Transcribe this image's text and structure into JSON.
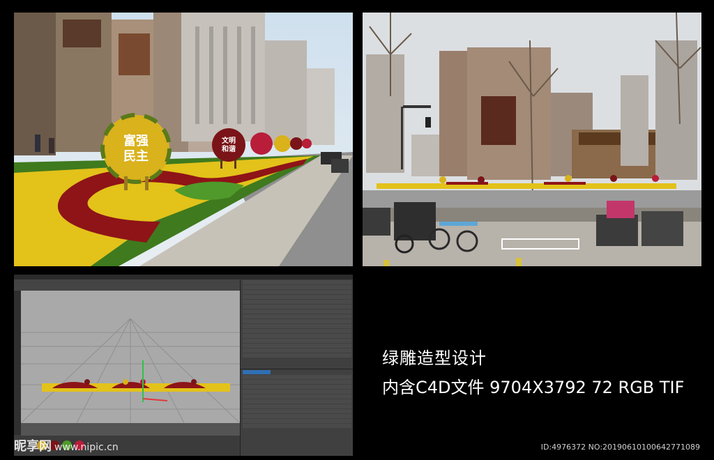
{
  "caption": {
    "line1": "绿雕造型设计",
    "line2": "内含C4D文件 9704X3792 72 RGB TIF"
  },
  "render_signs": {
    "big_ball": "富强\n民主",
    "ball_2": "文明\n和谐"
  },
  "watermark": {
    "brand": "昵享网",
    "url": "www.nipic.cn"
  },
  "id_line": "ID:4976372 NO:20190610100642771089",
  "colors": {
    "background": "#000000",
    "caption_text": "#ffffff",
    "flower_yellow": "#e3c21a",
    "flower_red": "#8e1418",
    "grass_green": "#4f9a2a"
  }
}
